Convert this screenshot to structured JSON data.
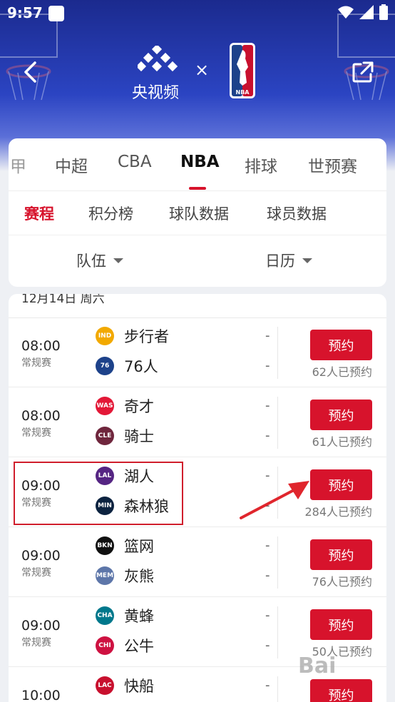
{
  "statusbar": {
    "time": "9:57"
  },
  "header": {
    "brand_name": "央视频",
    "times_sign": "×",
    "nba_logo_text": "NBA"
  },
  "tabs": [
    {
      "label": "甲"
    },
    {
      "label": "中超"
    },
    {
      "label": "CBA"
    },
    {
      "label": "NBA"
    },
    {
      "label": "排球"
    },
    {
      "label": "世预赛"
    }
  ],
  "subtabs": [
    {
      "label": "赛程"
    },
    {
      "label": "积分榜"
    },
    {
      "label": "球队数据"
    },
    {
      "label": "球员数据"
    }
  ],
  "filters": {
    "team": "队伍",
    "calendar": "日历"
  },
  "date_header": "12月14日 周六",
  "games": [
    {
      "time": "08:00",
      "stage": "常规赛",
      "home": "步行者",
      "away": "76人",
      "home_score": "-",
      "away_score": "-",
      "btn": "预约",
      "count": "62人已预约",
      "home_logo": {
        "abbr": "IND",
        "color": "#f2a900"
      },
      "away_logo": {
        "abbr": "76",
        "color": "#1d428a"
      }
    },
    {
      "time": "08:00",
      "stage": "常规赛",
      "home": "奇才",
      "away": "骑士",
      "home_score": "-",
      "away_score": "-",
      "btn": "预约",
      "count": "61人已预约",
      "home_logo": {
        "abbr": "WAS",
        "color": "#e31837"
      },
      "away_logo": {
        "abbr": "CLE",
        "color": "#6f263d"
      }
    },
    {
      "time": "09:00",
      "stage": "常规赛",
      "home": "湖人",
      "away": "森林狼",
      "home_score": "-",
      "away_score": "-",
      "btn": "预约",
      "count": "284人已预约",
      "home_logo": {
        "abbr": "LAL",
        "color": "#552583"
      },
      "away_logo": {
        "abbr": "MIN",
        "color": "#0c2340"
      }
    },
    {
      "time": "09:00",
      "stage": "常规赛",
      "home": "篮网",
      "away": "灰熊",
      "home_score": "-",
      "away_score": "-",
      "btn": "预约",
      "count": "76人已预约",
      "home_logo": {
        "abbr": "BKN",
        "color": "#111111"
      },
      "away_logo": {
        "abbr": "MEM",
        "color": "#5d76a9"
      }
    },
    {
      "time": "09:00",
      "stage": "常规赛",
      "home": "黄蜂",
      "away": "公牛",
      "home_score": "-",
      "away_score": "-",
      "btn": "预约",
      "count": "50人已预约",
      "home_logo": {
        "abbr": "CHA",
        "color": "#00788c"
      },
      "away_logo": {
        "abbr": "CHI",
        "color": "#ce1141"
      }
    },
    {
      "time": "10:00",
      "stage": "",
      "home": "快船",
      "away": "",
      "home_score": "-",
      "away_score": "",
      "btn": "预约",
      "count": "",
      "home_logo": {
        "abbr": "LAC",
        "color": "#c8102e"
      },
      "away_logo": {
        "abbr": "",
        "color": "#ffffff"
      }
    }
  ],
  "watermark": "Bai"
}
